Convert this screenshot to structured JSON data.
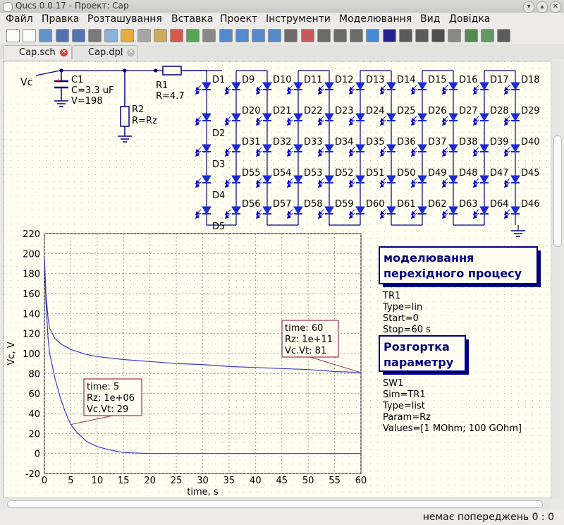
{
  "window": {
    "title": "Qucs 0.0.17 - Проект: Cap"
  },
  "menu": [
    "Файл",
    "Правка",
    "Розташування",
    "Вставка",
    "Проект",
    "Інструменти",
    "Моделювання",
    "Вид",
    "Довідка"
  ],
  "tabs": [
    {
      "label": "Cap.sch",
      "close_color": "#e0413a"
    },
    {
      "label": "Cap.dpl",
      "close_color": "#b9b9b6"
    }
  ],
  "schematic": {
    "vc_label": "Vc",
    "c1": {
      "name": "C1",
      "c": "C=3.3 uF",
      "v": "V=198"
    },
    "r1": {
      "name": "R1",
      "r": "R=4.7"
    },
    "r2": {
      "name": "R2",
      "r": "R=Rz"
    },
    "diode_labels": {
      "row0": [
        "D1",
        "D9",
        "D10",
        "D11",
        "D12",
        "D13",
        "D14",
        "D15",
        "D16",
        "D17",
        "D18"
      ],
      "row1": [
        "D20",
        "D21",
        "D22",
        "D23",
        "D24",
        "D25",
        "D26",
        "D27",
        "D28",
        "D29"
      ],
      "row2": [
        "D31",
        "D32",
        "D33",
        "D34",
        "D35",
        "D36",
        "D37",
        "D38",
        "D39",
        "D40"
      ],
      "row3": [
        "D55",
        "D54",
        "D53",
        "D52",
        "D51",
        "D50",
        "D49",
        "D48",
        "D47",
        "D45"
      ],
      "row4": [
        "D56",
        "D57",
        "D58",
        "D59",
        "D60",
        "D61",
        "D62",
        "D63",
        "D64",
        "D46"
      ],
      "col0": [
        "D2",
        "D3",
        "D4",
        "D5"
      ]
    }
  },
  "sim_box": {
    "title_line1": "моделювання",
    "title_line2": "перехідного процесу",
    "lines": [
      "TR1",
      "Type=lin",
      "Start=0",
      "Stop=60 s"
    ]
  },
  "sweep_box": {
    "title_line1": "Розгортка",
    "title_line2": "параметру",
    "lines": [
      "SW1",
      "Sim=TR1",
      "Type=list",
      "Param=Rz",
      "Values=[1 MOhm; 100 GOhm]"
    ]
  },
  "markers": [
    {
      "lines": [
        "time: 60",
        "Rz: 1e+11",
        "Vc.Vt: 81"
      ]
    },
    {
      "lines": [
        "time: 5",
        "Rz: 1e+06",
        "Vc.Vt: 29"
      ]
    }
  ],
  "chart_data": {
    "type": "line",
    "xlabel": "time, s",
    "ylabel": "Vc, V",
    "xlim": [
      0,
      60
    ],
    "ylim": [
      -20,
      220
    ],
    "xticks": [
      0,
      5,
      10,
      15,
      20,
      25,
      30,
      35,
      40,
      45,
      50,
      55,
      60
    ],
    "yticks": [
      -20,
      0,
      20,
      40,
      60,
      80,
      100,
      120,
      140,
      160,
      180,
      200,
      220
    ],
    "grid": true,
    "series": [
      {
        "color": "#3a3ad0",
        "x": [
          0,
          0.3,
          0.7,
          1,
          2,
          3,
          5,
          8,
          10,
          15,
          20,
          25,
          30,
          35,
          40,
          45,
          50,
          55,
          60
        ],
        "y": [
          195,
          160,
          135,
          125,
          115,
          110,
          104,
          99,
          97,
          94,
          92,
          90,
          89,
          87,
          86,
          85,
          84,
          82,
          81
        ]
      },
      {
        "color": "#3a3ad0",
        "x": [
          0,
          0.3,
          0.7,
          1,
          2,
          3,
          4,
          5,
          6,
          8,
          10,
          12,
          15,
          20,
          25,
          30,
          40,
          50,
          60
        ],
        "y": [
          195,
          150,
          115,
          100,
          75,
          56,
          41,
          29,
          22,
          12,
          7,
          4,
          1,
          0,
          0,
          0,
          0,
          0,
          0
        ]
      }
    ]
  },
  "status": {
    "message": "немає попереджень 0 : 0"
  },
  "colors": {
    "canvas_bg": "#fffdf0",
    "wire": "#000080",
    "diode": "#0000cc",
    "grid_dot": "#bcbcbc",
    "box_title": "#000080"
  },
  "toolbar_icons": [
    "new-icon",
    "new-text-icon",
    "open-icon",
    "save-icon",
    "save-all-icon",
    "close-icon",
    "print-icon",
    "cut-icon",
    "copy-icon",
    "paste-icon",
    "delete-icon",
    "undo-icon",
    "redo-icon",
    "zoom-fit-icon",
    "zoom-in-icon",
    "zoom-out-icon",
    "zoom-selection-icon",
    "select-icon",
    "deactivate-icon",
    "rotate-icon",
    "mirror-x-icon",
    "mirror-y-icon",
    "go-into-icon",
    "wire-icon",
    "label-icon",
    "equation-icon",
    "ground-icon",
    "port-icon",
    "simulate-icon",
    "view-data-icon",
    "marker-icon"
  ]
}
